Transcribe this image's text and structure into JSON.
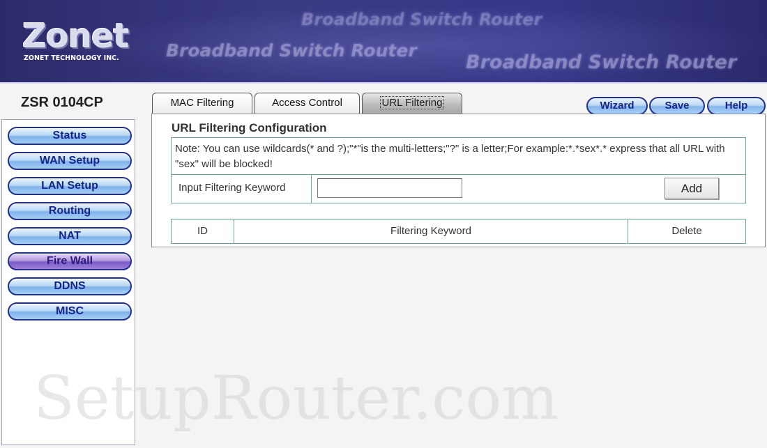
{
  "banner": {
    "logo_text": "Zonet",
    "logo_subtitle": "ZONET TECHNOLOGY INC.",
    "tagline_1": "Broadband Switch Router",
    "tagline_2": "Broadband Switch Router",
    "tagline_3": "Broadband Switch Router"
  },
  "sidebar": {
    "model": "ZSR 0104CP",
    "items": [
      {
        "label": "Status"
      },
      {
        "label": "WAN Setup"
      },
      {
        "label": "LAN Setup"
      },
      {
        "label": "Routing"
      },
      {
        "label": "NAT"
      },
      {
        "label": "Fire Wall",
        "active": true
      },
      {
        "label": "DDNS"
      },
      {
        "label": "MISC"
      }
    ]
  },
  "tabs": [
    {
      "label": "MAC Filtering"
    },
    {
      "label": "Access Control"
    },
    {
      "label": "URL Filtering",
      "active": true
    }
  ],
  "actions": {
    "wizard": "Wizard",
    "save": "Save",
    "help": "Help"
  },
  "config": {
    "title": "URL Filtering Configuration",
    "note": "Note: You can use wildcards(* and ?);\"*\"is the multi-letters;\"?\" is a letter;For example:*.*sex*.* express that all URL with \"sex\" will be blocked!",
    "keyword_label": "Input Filtering Keyword",
    "keyword_value": "",
    "add_label": "Add"
  },
  "list": {
    "headers": [
      "ID",
      "Filtering Keyword",
      "Delete"
    ]
  },
  "watermark": "SetupRouter.com",
  "colors": {
    "banner": "#38388a",
    "nav_text": "#16268c",
    "table_border": "#6aa690"
  }
}
